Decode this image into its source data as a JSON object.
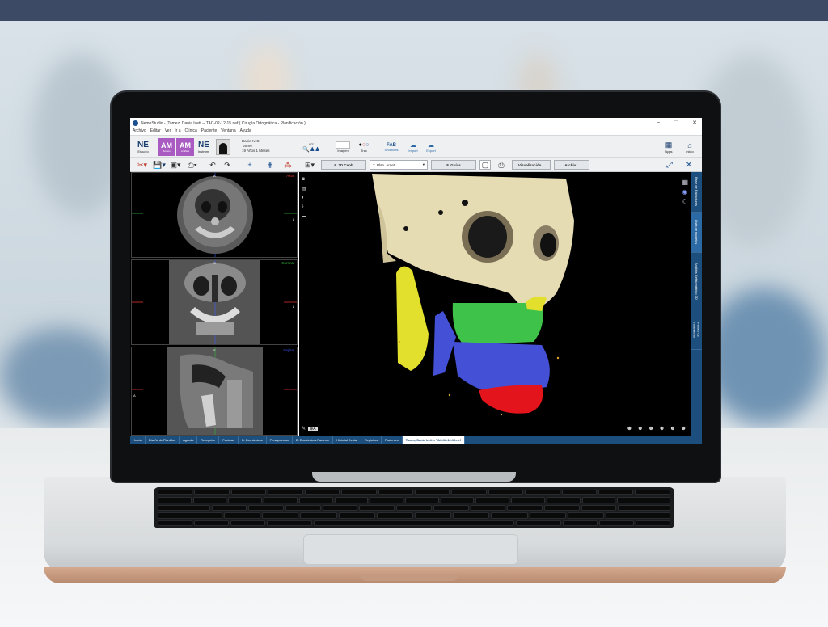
{
  "app": {
    "window_title": "NemoStudio - [Tamez, Dania Ivett -- TAC-02-12-15.nef ( Cirugía Ortognática - Planificación )]",
    "window_buttons": [
      "–",
      "❐",
      "✕"
    ]
  },
  "menu": [
    "Archivo",
    "Editar",
    "Ver",
    "Ir a",
    "Clínica",
    "Paciente",
    "Ventana",
    "Ayuda"
  ],
  "ribbon": {
    "modules": [
      {
        "logo": "NE",
        "label": "Estudio"
      },
      {
        "logo": "AM",
        "label": "Boceto"
      },
      {
        "logo": "AM",
        "label": "Análisis"
      },
      {
        "logo": "NE",
        "label": "Instrum."
      }
    ],
    "patient": {
      "name": "Dania Ivett",
      "surname": "Tamez",
      "age": "19 Años 1 Meses"
    },
    "angle": "90°",
    "groups": [
      "Imagen",
      "Trac",
      "Shortcuts",
      "Import",
      "Export"
    ],
    "fab_label": "FAB",
    "right": [
      {
        "label": "Apps"
      },
      {
        "label": "Inicio"
      }
    ]
  },
  "toolbar": {
    "ceph_button": "6. 2D Ceph",
    "plan_select": "7. Plan. Arnett",
    "guides_button": "8. Guías",
    "visualization_button": "Visualización...",
    "archive_button": "Archiv..."
  },
  "viewports": [
    {
      "label": "Axial",
      "color": "#e0332f",
      "top_marker": "A",
      "left_marker": "",
      "right_marker": "L"
    },
    {
      "label": "Coronal",
      "color": "#2fb83a",
      "top_marker": "S",
      "left_marker": "",
      "right_marker": "L"
    },
    {
      "label": "Sagital",
      "color": "#3d5cff",
      "top_marker": "S",
      "left_marker": "A",
      "right_marker": ""
    }
  ],
  "side_tabs": [
    "Base de Estructuras",
    "Lista de modelos",
    "Análisis Cefalométrico 3D",
    "Planes de Tratamiento"
  ],
  "side_tab_active": 1,
  "tabs": [
    "Inicio",
    "Diseño de Plantillas",
    "Agenda",
    "Recepción",
    "Facturas",
    "D. Económicos",
    "Presupuestos",
    "D. Económicos Paciente",
    "Historial Dental",
    "Registros",
    "Pacientes",
    "Tamez, Dania Ivett -- TAC-02-12-15.nef"
  ],
  "active_tab": 11,
  "colors": {
    "banner": "#3d4a66",
    "accent": "#1c4f7d",
    "bone": "#e6dcb4",
    "segment_green": "#3fc24a",
    "segment_blue": "#4451d6",
    "segment_red": "#e3141c",
    "segment_yellow": "#e2e02c"
  }
}
